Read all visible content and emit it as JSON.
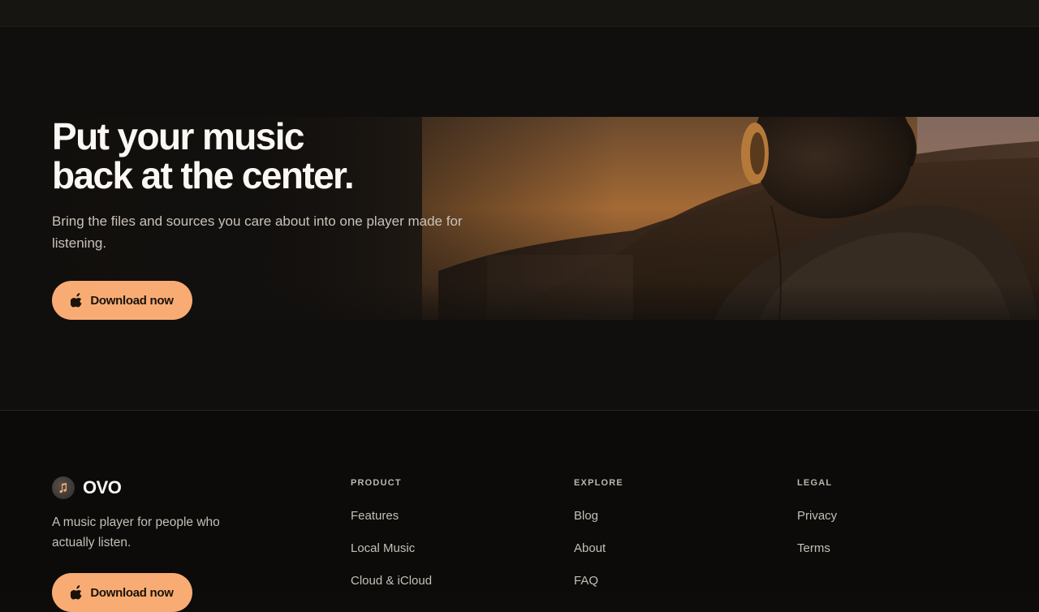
{
  "hero": {
    "headline_line1": "Put your music",
    "headline_line2": "back at the center.",
    "subheading": "Bring the files and sources you care about into one player made for listening.",
    "cta_label": "Download now",
    "cta_icon": "apple-icon"
  },
  "footer": {
    "brand_name": "OVO",
    "brand_icon": "music-note-icon",
    "tagline": "A music player for people who actually listen.",
    "cta_label": "Download now",
    "columns": [
      {
        "title": "PRODUCT",
        "links": [
          "Features",
          "Local Music",
          "Cloud & iCloud"
        ]
      },
      {
        "title": "EXPLORE",
        "links": [
          "Blog",
          "About",
          "FAQ"
        ]
      },
      {
        "title": "LEGAL",
        "links": [
          "Privacy",
          "Terms"
        ]
      }
    ]
  },
  "colors": {
    "accent": "#f8ac73",
    "background": "#0d0c0b",
    "text_primary": "#fbf8f3",
    "text_secondary": "#c6bfb6"
  }
}
